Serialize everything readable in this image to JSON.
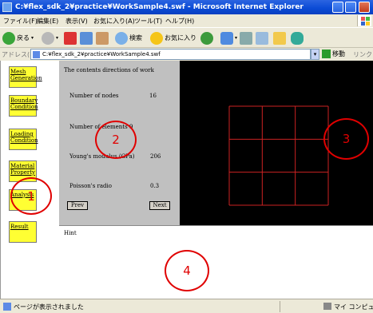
{
  "window": {
    "title": "C:¥flex_sdk_2¥practice¥WorkSample4.swf - Microsoft Internet Explorer"
  },
  "menubar": {
    "items": [
      "ファイル(F)",
      "編集(E)",
      "表示(V)",
      "お気に入り(A)",
      "ツール(T)",
      "ヘルプ(H)"
    ]
  },
  "toolbar": {
    "back_label": "戻る",
    "search_label": "検索",
    "favorites_label": "お気に入り"
  },
  "addressbar": {
    "label": "アドレス(D)",
    "url": "C:¥flex_sdk_2¥practice¥WorkSample4.swf",
    "go_label": "移動",
    "links_label": "リンク"
  },
  "app": {
    "menu_buttons": [
      {
        "line1": "Mesh",
        "line2": "Generation"
      },
      {
        "line1": "Boundary",
        "line2": "Condition"
      },
      {
        "line1": "Loading",
        "line2": "Condition"
      },
      {
        "line1": "Material",
        "line2": "Property"
      },
      {
        "line1": "Analysis",
        "line2": ""
      },
      {
        "line1": "Result",
        "line2": ""
      }
    ],
    "form": {
      "heading": "The contents directions of work",
      "nodes_label": "Number of nodes",
      "nodes_value": "16",
      "elements_label": "Number of elements",
      "elements_value": "9",
      "youngs_label": "Young's modulus (GPa)",
      "youngs_value": "206",
      "poisson_label": "Poisson's radio",
      "poisson_value": "0.3",
      "prev_label": "Prev",
      "next_label": "Next"
    },
    "mesh": {
      "rows": 3,
      "cols": 3,
      "line_color": "#cc2222"
    },
    "hint_label": "Hint"
  },
  "annotations": [
    "1",
    "2",
    "3",
    "4"
  ],
  "statusbar": {
    "text": "ページが表示されました",
    "zone": "マイ コンピュータ"
  },
  "colors": {
    "annotation": "#e00000",
    "menu_button": "#ffff33",
    "panel": "#c0c0c0",
    "canvas": "#000000"
  }
}
